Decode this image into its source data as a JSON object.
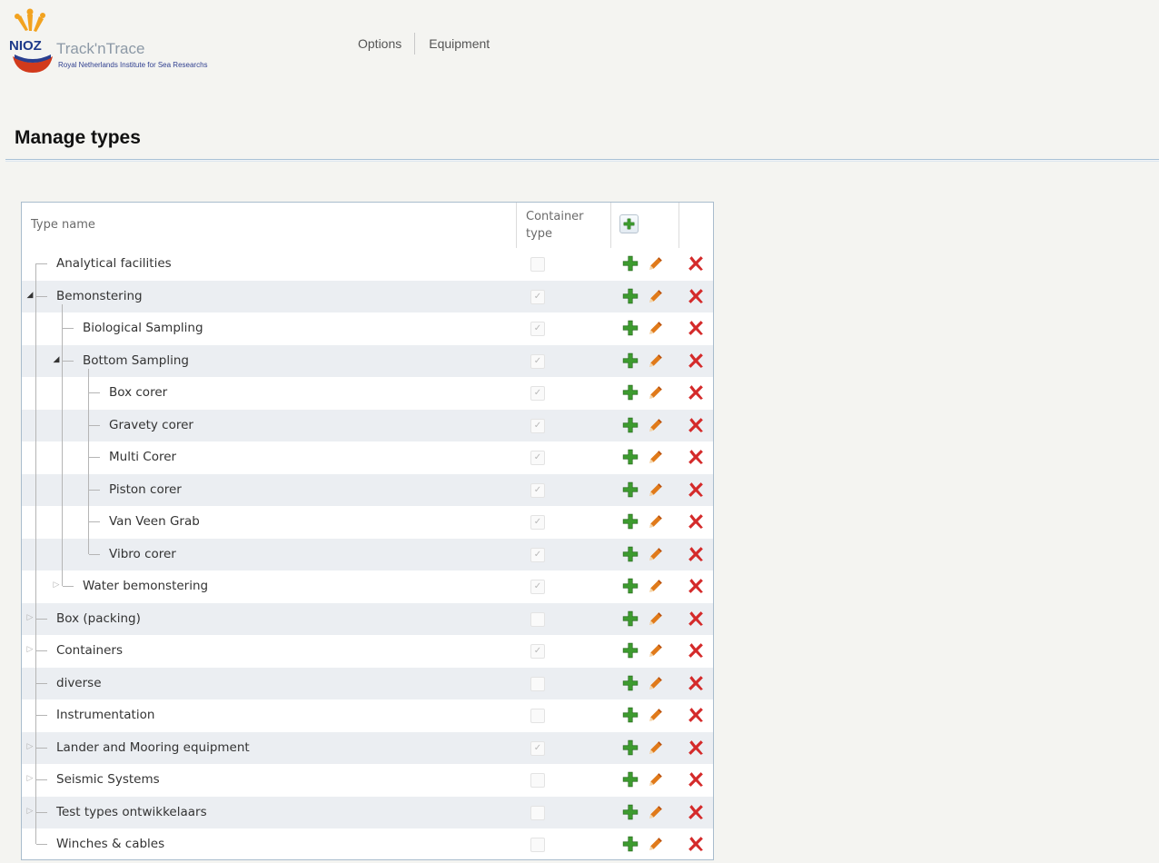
{
  "logo": {
    "brand": "NIOZ",
    "app_name": "Track'nTrace",
    "subtitle": "Royal Netherlands Institute for Sea Researchs"
  },
  "nav": {
    "items": [
      "Options",
      "Equipment"
    ]
  },
  "page": {
    "title": "Manage types"
  },
  "grid": {
    "headers": {
      "name": "Type name",
      "container": "Container type"
    },
    "rows": [
      {
        "name": "Analytical facilities",
        "level": 0,
        "expander": "none",
        "container": false
      },
      {
        "name": "Bemonstering",
        "level": 0,
        "expander": "open",
        "container": true
      },
      {
        "name": "Biological Sampling",
        "level": 1,
        "expander": "none",
        "container": true
      },
      {
        "name": "Bottom Sampling",
        "level": 1,
        "expander": "open",
        "container": true
      },
      {
        "name": "Box corer",
        "level": 2,
        "expander": "none",
        "container": true
      },
      {
        "name": "Gravety corer",
        "level": 2,
        "expander": "none",
        "container": true
      },
      {
        "name": "Multi Corer",
        "level": 2,
        "expander": "none",
        "container": true
      },
      {
        "name": "Piston corer",
        "level": 2,
        "expander": "none",
        "container": true
      },
      {
        "name": "Van Veen Grab",
        "level": 2,
        "expander": "none",
        "container": true
      },
      {
        "name": "Vibro corer",
        "level": 2,
        "expander": "none",
        "container": true
      },
      {
        "name": "Water bemonstering",
        "level": 1,
        "expander": "closed",
        "container": true
      },
      {
        "name": "Box (packing)",
        "level": 0,
        "expander": "closed",
        "container": false
      },
      {
        "name": "Containers",
        "level": 0,
        "expander": "closed",
        "container": true
      },
      {
        "name": "diverse",
        "level": 0,
        "expander": "none",
        "container": false
      },
      {
        "name": "Instrumentation",
        "level": 0,
        "expander": "none",
        "container": false
      },
      {
        "name": "Lander and Mooring equipment",
        "level": 0,
        "expander": "closed",
        "container": true
      },
      {
        "name": "Seismic Systems",
        "level": 0,
        "expander": "closed",
        "container": false
      },
      {
        "name": "Test types ontwikkelaars",
        "level": 0,
        "expander": "closed",
        "container": false
      },
      {
        "name": "Winches & cables",
        "level": 0,
        "expander": "none",
        "container": false
      }
    ]
  },
  "icons": {
    "add": "plus-icon",
    "edit": "pencil-icon",
    "delete": "cross-icon"
  },
  "colors": {
    "add_green": "#3d9b2f",
    "edit_orange": "#e07a1a",
    "delete_red": "#d42a2a",
    "row_alt": "#ebeef2",
    "border": "#a9bccd"
  }
}
